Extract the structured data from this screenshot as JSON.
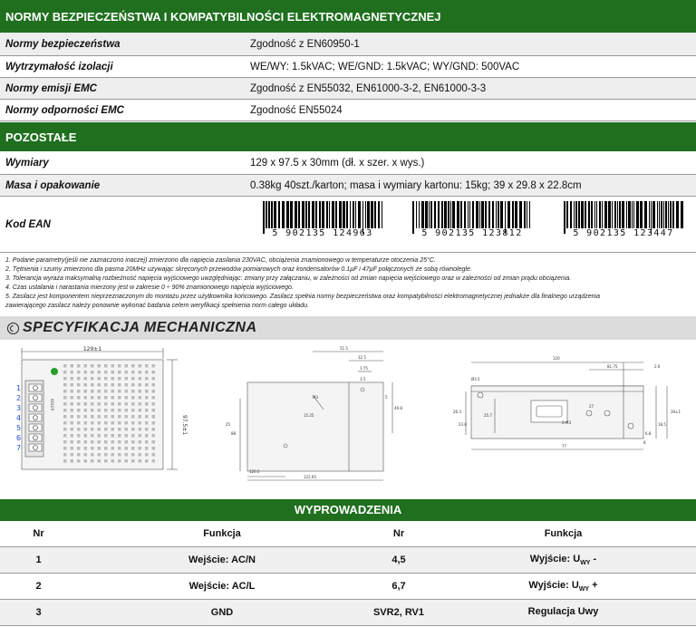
{
  "safety": {
    "header": "NORMY BEZPIECZEŃSTWA I KOMPATYBILNOŚCI ELEKTROMAGNETYCZNEJ",
    "rows": [
      {
        "label": "Normy bezpieczeństwa",
        "value": "Zgodność z EN60950-1"
      },
      {
        "label": "Wytrzymałość izolacji",
        "value": "WE/WY: 1.5kVAC; WE/GND: 1.5kVAC; WY/GND: 500VAC"
      },
      {
        "label": "Normy emisji EMC",
        "value": "Zgodność z EN55032, EN61000-3-2, EN61000-3-3"
      },
      {
        "label": "Normy odporności EMC",
        "value": "Zgodność  EN55024"
      }
    ]
  },
  "other": {
    "header": "POZOSTAŁE",
    "rows": [
      {
        "label": "Wymiary",
        "value": "129 x 97.5 x 30mm (dł. x szer. x wys.)"
      },
      {
        "label": "Masa i opakowanie",
        "value": "0.38kg 40szt./karton; masa i wymiary kartonu: 15kg; 39 x 29.8 x 22.8cm"
      }
    ],
    "ean_label": "Kod EAN",
    "barcodes": [
      "5 902135 124963",
      "5 902135 123812",
      "5 902135 123447"
    ]
  },
  "notes": [
    "1. Podane parametry(jeśli nie zaznaczono inaczej) zmierzono dla napięcia zasilania 230VAC, obciążenia  znamionowego w temperaturze otoczenia  25°C.",
    "2. Tętnienia i szumy zmierzono dla pasma 20MHz używając skręconych przewodów pomiarowych oraz kondensatorów 0.1µF i 47µF połączonych ze sobą równolegle.",
    "3. Tolerancja wyraża maksymalną rozbieżność napięcia wyjściowego uwzględniając: zmiany przy załączaniu, w zależności od zmian napięcia wejściowego oraz w zależności od zmian prądu obciążenia.",
    "4. Czas ustalania i narastania mierzony jest w zakresie 0 ÷ 90% znamionowego napięcia wyjściowego.",
    "5. Zasilacz jest komponentem nieprzeznaczonym do montażu przez użytkownika końcowego. Zasilacz spełnia normy bezpieczeństwa oraz kompatybilności elektromagnetycznej jednakże dla finalnego urządzenia",
    "zawierającego zasilacz należy ponownie wykonać badania celem weryfikacji spełnienia norm całego układu."
  ],
  "mechanical": {
    "header": "SPECYFIKACJA MECHANICZNA",
    "front": {
      "width_label": "129±1",
      "height_label": "97.5±1",
      "pins": [
        "1",
        "2",
        "3",
        "4",
        "5",
        "6",
        "7"
      ],
      "brand": "ADLER"
    },
    "side": {
      "dims": [
        "51.5",
        "32.5",
        "1.75",
        "3.5",
        "49.8",
        "5",
        "25",
        "88",
        "120.5",
        "15.25",
        "M3",
        "122.95"
      ]
    },
    "bottom": {
      "dims": [
        "120",
        "81.75",
        "2.6",
        "Ø3.5",
        "26.3",
        "23.8",
        "25.7",
        "27",
        "2-M3",
        "30±1",
        "18.5",
        "8",
        "77",
        "6.8"
      ]
    }
  },
  "pins": {
    "header": "WYPROWADZENIA",
    "columns": [
      "Nr",
      "Funkcja",
      "Nr",
      "Funkcja"
    ],
    "rows": [
      {
        "nr1": "1",
        "f1": "Wejście: AC/N",
        "nr2": "4,5",
        "f2": "Wyjście: U",
        "f2sub": "WY",
        "f2suf": " -"
      },
      {
        "nr1": "2",
        "f1": "Wejście: AC/L",
        "nr2": "6,7",
        "f2": "Wyjście: U",
        "f2sub": "WY",
        "f2suf": " +"
      },
      {
        "nr1": "3",
        "f1": "GND",
        "nr2": "SVR2, RV1",
        "f2": "Regulacja Uwy",
        "f2sub": "",
        "f2suf": ""
      }
    ]
  },
  "colors": {
    "header_green": "#1f6f1f",
    "pin_blue": "#1f4fd8"
  }
}
